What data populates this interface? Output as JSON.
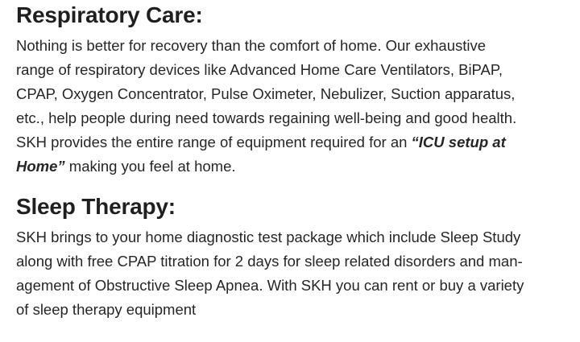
{
  "sections": [
    {
      "title": "Respiratory Care:",
      "lines": [
        "Nothing is better for recovery than the comfort of home. Our exhaustive",
        "range of respiratory devices like Advanced Home Care Ventilators, BiPAP,",
        "CPAP, Oxygen Concentrator, Pulse Oximeter, Nebulizer, Suction apparatus,",
        "etc., help people during need towards regaining well-being and good health."
      ],
      "line5_before": "SKH provides the entire range of equipment required for an ",
      "emphasis_part1": "“ICU setup at",
      "emphasis_part2": "Home”",
      "line6_after": " making you feel at home."
    },
    {
      "title": "Sleep Therapy:",
      "lines": [
        "SKH brings to your home diagnostic test package which include Sleep Study",
        "along with free CPAP titration for 2 days for sleep related disorders and man-",
        "agement of Obstructive Sleep Apnea. With SKH you can rent or buy a variety",
        "of sleep therapy equipment"
      ]
    }
  ]
}
